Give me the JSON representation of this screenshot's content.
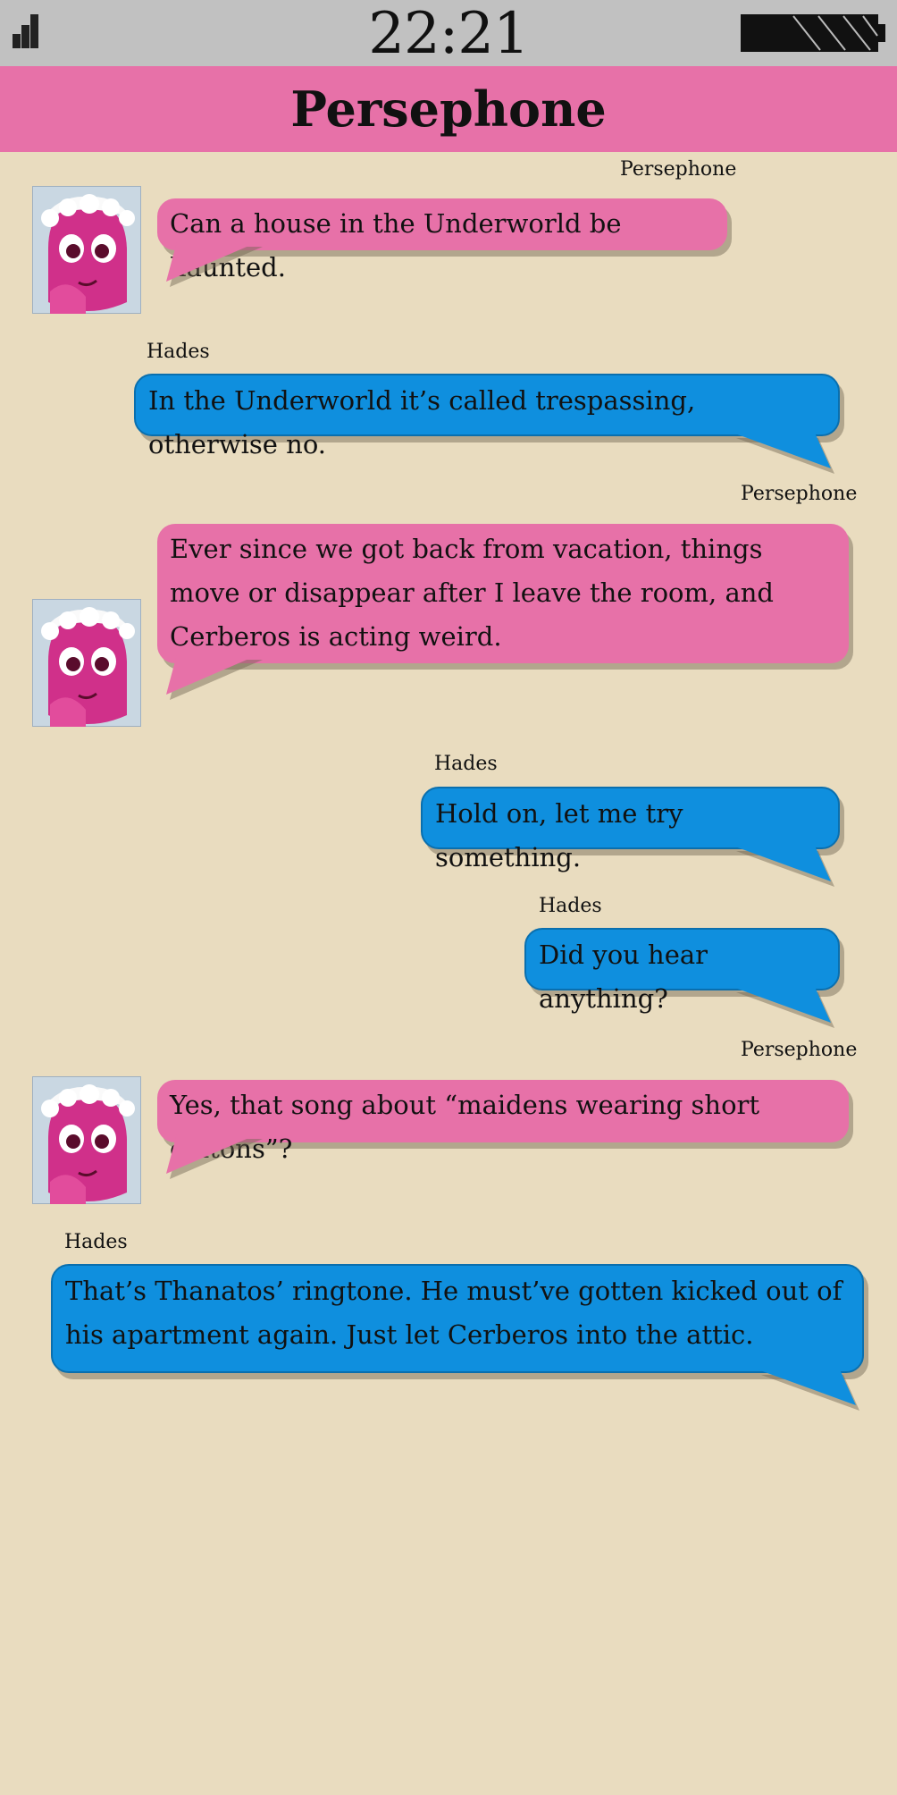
{
  "status_bar": {
    "time": "22:21"
  },
  "header": {
    "title": "Persephone"
  },
  "colors": {
    "status_bar_bg": "#c1c1c1",
    "header_bg": "#e771a8",
    "page_bg": "#e9dcbf",
    "incoming_bubble": "#e771a8",
    "outgoing_bubble": "#0f8fde"
  },
  "messages": [
    {
      "sender": "Persephone",
      "side": "left",
      "avatar": "persephone-avatar",
      "text": "Can a house in the Underworld be haunted."
    },
    {
      "sender": "Hades",
      "side": "right",
      "text": "In the Underworld it’s called trespassing, otherwise no."
    },
    {
      "sender": "Persephone",
      "side": "left",
      "avatar": "persephone-avatar",
      "text": "Ever since we got back from vacation, things move or disappear after I leave the room, and Cerberos is acting weird."
    },
    {
      "sender": "Hades",
      "side": "right",
      "text": "Hold on, let me try something."
    },
    {
      "sender": "Hades",
      "side": "right",
      "text": "Did you hear anything?"
    },
    {
      "sender": "Persephone",
      "side": "left",
      "avatar": "persephone-avatar",
      "text": "Yes, that song about “maidens wearing short chitons”?"
    },
    {
      "sender": "Hades",
      "side": "right",
      "text": "That’s Thanatos’ ringtone. He must’ve gotten kicked out of his apartment again. Just let Cerberos into the attic."
    }
  ]
}
